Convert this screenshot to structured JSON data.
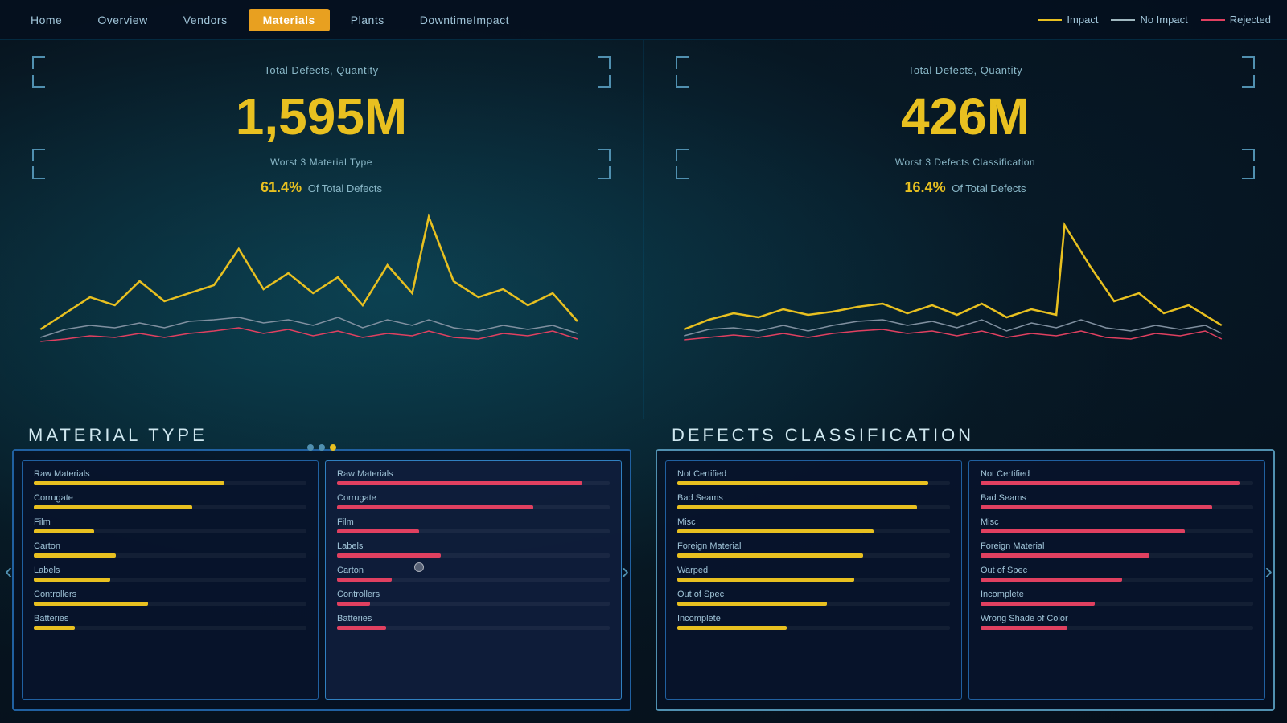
{
  "topbar": {
    "nav_items": [
      {
        "label": "Home",
        "active": false
      },
      {
        "label": "Overview",
        "active": false
      },
      {
        "label": "Vendors",
        "active": false
      },
      {
        "label": "Materials",
        "active": true
      },
      {
        "label": "Plants",
        "active": false
      },
      {
        "label": "DowntimeImpact",
        "active": false
      }
    ],
    "legend": [
      {
        "label": "Impact",
        "color": "yellow"
      },
      {
        "label": "No Impact",
        "color": "white"
      },
      {
        "label": "Rejected",
        "color": "pink"
      }
    ]
  },
  "left_panel": {
    "chart_label": "Total Defects, Quantity",
    "big_number": "1,595M",
    "sub_label": "Worst 3 Material Type",
    "pct_value": "61.4%",
    "pct_text": "Of Total Defects",
    "section_title": "Material Type"
  },
  "right_panel": {
    "chart_label": "Total Defects, Quantity",
    "big_number": "426M",
    "sub_label": "Worst 3 Defects Classification",
    "pct_value": "16.4%",
    "pct_text": "Of Total Defects",
    "section_title": "Defects Classification"
  },
  "left_bars_col1": [
    {
      "label": "Raw Materials",
      "yellow": 70,
      "pink": 0
    },
    {
      "label": "Corrugate",
      "yellow": 58,
      "pink": 0
    },
    {
      "label": "Film",
      "yellow": 22,
      "pink": 0
    },
    {
      "label": "Carton",
      "yellow": 30,
      "pink": 0
    },
    {
      "label": "Labels",
      "yellow": 28,
      "pink": 0
    },
    {
      "label": "Controllers",
      "yellow": 42,
      "pink": 0
    },
    {
      "label": "Batteries",
      "yellow": 15,
      "pink": 0
    }
  ],
  "left_bars_col2": [
    {
      "label": "Raw Materials",
      "yellow": 0,
      "pink": 90
    },
    {
      "label": "Corrugate",
      "yellow": 0,
      "pink": 72
    },
    {
      "label": "Film",
      "yellow": 0,
      "pink": 30
    },
    {
      "label": "Labels",
      "yellow": 0,
      "pink": 38
    },
    {
      "label": "Carton",
      "yellow": 0,
      "pink": 20
    },
    {
      "label": "Controllers",
      "yellow": 0,
      "pink": 12
    },
    {
      "label": "Batteries",
      "yellow": 0,
      "pink": 18
    }
  ],
  "right_bars_col1": [
    {
      "label": "Not Certified",
      "yellow": 92,
      "pink": 0
    },
    {
      "label": "Bad Seams",
      "yellow": 88,
      "pink": 0
    },
    {
      "label": "Misc",
      "yellow": 72,
      "pink": 0
    },
    {
      "label": "Foreign Material",
      "yellow": 68,
      "pink": 0
    },
    {
      "label": "Warped",
      "yellow": 65,
      "pink": 0
    },
    {
      "label": "Out of Spec",
      "yellow": 55,
      "pink": 0
    },
    {
      "label": "Incomplete",
      "yellow": 40,
      "pink": 0
    }
  ],
  "right_bars_col2": [
    {
      "label": "Not Certified",
      "yellow": 0,
      "pink": 95
    },
    {
      "label": "Bad Seams",
      "yellow": 0,
      "pink": 85
    },
    {
      "label": "Misc",
      "yellow": 0,
      "pink": 75
    },
    {
      "label": "Foreign Material",
      "yellow": 0,
      "pink": 62
    },
    {
      "label": "Out of Spec",
      "yellow": 0,
      "pink": 52
    },
    {
      "label": "Incomplete",
      "yellow": 0,
      "pink": 42
    },
    {
      "label": "Wrong Shade of Color",
      "yellow": 0,
      "pink": 32
    }
  ]
}
